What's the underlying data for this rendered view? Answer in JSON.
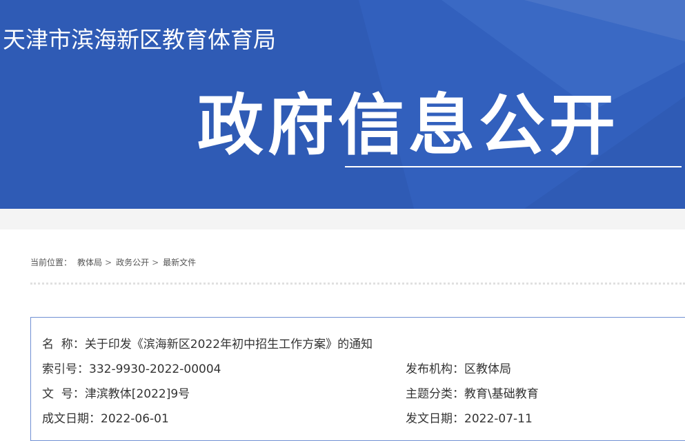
{
  "header": {
    "site_title": "天津市滨海新区教育体育局",
    "hero_title": "政府信息公开"
  },
  "breadcrumb": {
    "label": "当前位置：",
    "items": [
      "教体局",
      "政务公开",
      "最新文件"
    ],
    "separator": ">"
  },
  "doc_info": {
    "name_label": "名  称：",
    "name_value": "关于印发《滨海新区2022年初中招生工作方案》的通知",
    "index_label": "索引号：",
    "index_value": "332-9930-2022-00004",
    "publisher_label": "发布机构：",
    "publisher_value": "区教体局",
    "docno_label": "文  号：",
    "docno_value": "津滨教体[2022]9号",
    "topic_label": "主题分类：",
    "topic_value": "教育\\基础教育",
    "created_label": "成文日期：",
    "created_value": "2022-06-01",
    "issued_label": "发文日期：",
    "issued_value": "2022-07-11"
  },
  "colors": {
    "banner_blue": "#2f5bb5",
    "box_border": "#6f8fd3"
  }
}
